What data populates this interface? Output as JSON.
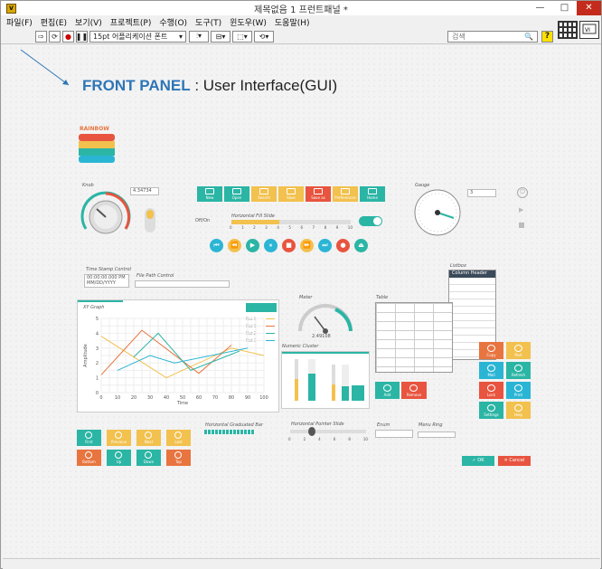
{
  "window": {
    "title": "제목없음 1 프런트패널 *",
    "min": "—",
    "max": "□",
    "close": "✕",
    "app_icon": "labview-app-icon"
  },
  "menu": [
    "파일(F)",
    "편집(E)",
    "보기(V)",
    "프로젝트(P)",
    "수행(O)",
    "도구(T)",
    "윈도우(W)",
    "도움말(H)"
  ],
  "toolbar": {
    "font": "15pt 어플리케이션 폰트",
    "search_placeholder": "검색",
    "help": "?"
  },
  "heading": {
    "front": "FRONT PANEL",
    "rest": " : User Interface(GUI)"
  },
  "logo": "RAINBOW",
  "labels": {
    "knob": "Knob",
    "knob_value": "4.34734",
    "gauge": "Gauge",
    "gauge_value": "3",
    "fill_slide": "Horizontal Fill Slide",
    "off_on": "Off/On",
    "timestamp": "Time Stamp Control",
    "timestamp_value": "00:00:00.000 PM",
    "date_value": "MM/DD/YYYY",
    "filepath": "File Path Control",
    "listbox": "Listbox",
    "column_header": "Column Header",
    "xy_graph": "XY Graph",
    "meter": "Meter",
    "meter_value": "2.49108",
    "table": "Table",
    "numeric_cluster": "Numeric Cluster",
    "amplitude": "Amplitude",
    "time": "Time",
    "h_bar": "Horizontal Graduated Bar",
    "h_pointer": "Horizontal Pointer Slide",
    "enum": "Enum",
    "menu_ring": "Menu Ring"
  },
  "fill_ticks": [
    "0",
    "1",
    "2",
    "3",
    "4",
    "5",
    "6",
    "7",
    "8",
    "9",
    "10"
  ],
  "pointer_ticks": [
    "0",
    "2",
    "4",
    "6",
    "8",
    "10"
  ],
  "top_buttons": [
    {
      "label": "New",
      "color": "#2bb5a5"
    },
    {
      "label": "Open",
      "color": "#2bb5a5"
    },
    {
      "label": "Search",
      "color": "#f2c14e"
    },
    {
      "label": "Save",
      "color": "#f2c14e"
    },
    {
      "label": "Save as",
      "color": "#e8543f"
    },
    {
      "label": "Preferences",
      "color": "#f2c14e"
    },
    {
      "label": "Home",
      "color": "#2bb5a5"
    }
  ],
  "media_buttons": [
    {
      "glyph": "⏮",
      "color": "#2bb5d5"
    },
    {
      "glyph": "⏪",
      "color": "#f2c14e"
    },
    {
      "glyph": "▶",
      "color": "#2bb5a5"
    },
    {
      "glyph": "⏸",
      "color": "#2bb5d5"
    },
    {
      "glyph": "■",
      "color": "#e8543f"
    },
    {
      "glyph": "⏩",
      "color": "#f2c14e"
    },
    {
      "glyph": "⏭",
      "color": "#2bb5d5"
    },
    {
      "glyph": "●",
      "color": "#e8543f"
    },
    {
      "glyph": "⏏",
      "color": "#2bb5a5"
    }
  ],
  "side_buttons": [
    {
      "label": "Copy",
      "color": "#e8743f"
    },
    {
      "label": "Past",
      "color": "#f2c14e"
    },
    {
      "label": "Mail",
      "color": "#2bb5d5"
    },
    {
      "label": "Refresh",
      "color": "#2bb5a5"
    },
    {
      "label": "Lock",
      "color": "#e8543f"
    },
    {
      "label": "Print",
      "color": "#2bb5d5"
    },
    {
      "label": "Settings",
      "color": "#2bb5a5"
    },
    {
      "label": "Help",
      "color": "#f2c14e"
    }
  ],
  "nav_buttons": [
    {
      "label": "First",
      "color": "#2bb5a5"
    },
    {
      "label": "Previous",
      "color": "#f2c14e"
    },
    {
      "label": "Next",
      "color": "#f2c14e"
    },
    {
      "label": "Last",
      "color": "#f2c14e"
    },
    {
      "label": "Bottom",
      "color": "#e8743f"
    },
    {
      "label": "Up",
      "color": "#2bb5a5"
    },
    {
      "label": "Down",
      "color": "#2bb5a5"
    },
    {
      "label": "Top",
      "color": "#e8743f"
    }
  ],
  "table_buttons": {
    "add": "Add",
    "remove": "Remove"
  },
  "dialog": {
    "ok": "OK",
    "cancel": "Cancel"
  },
  "plots": [
    "Plot 0",
    "Plot 1",
    "Plot 2",
    "Plot 3"
  ],
  "chart_data": {
    "type": "line",
    "x_ticks": [
      "0",
      "10",
      "20",
      "30",
      "40",
      "50",
      "60",
      "70",
      "80",
      "90",
      "100"
    ],
    "y_ticks": [
      "0",
      "1",
      "2",
      "3",
      "4",
      "5"
    ],
    "xlim": [
      0,
      100
    ],
    "ylim": [
      0,
      5
    ],
    "series": [
      {
        "name": "Plot 0",
        "color": "#f2c14e",
        "x": [
          0,
          40,
          80,
          100
        ],
        "y": [
          3.8,
          1.0,
          3.0,
          2.5
        ]
      },
      {
        "name": "Plot 1",
        "color": "#e8743f",
        "x": [
          0,
          25,
          60,
          80
        ],
        "y": [
          1.2,
          4.2,
          1.3,
          3.2
        ]
      },
      {
        "name": "Plot 2",
        "color": "#2bb5a5",
        "x": [
          20,
          35,
          55,
          85
        ],
        "y": [
          2.4,
          4.0,
          1.5,
          2.8
        ]
      },
      {
        "name": "Plot 3",
        "color": "#2bb5d5",
        "x": [
          10,
          30,
          45,
          90
        ],
        "y": [
          1.5,
          2.5,
          2.0,
          3.0
        ]
      }
    ]
  }
}
